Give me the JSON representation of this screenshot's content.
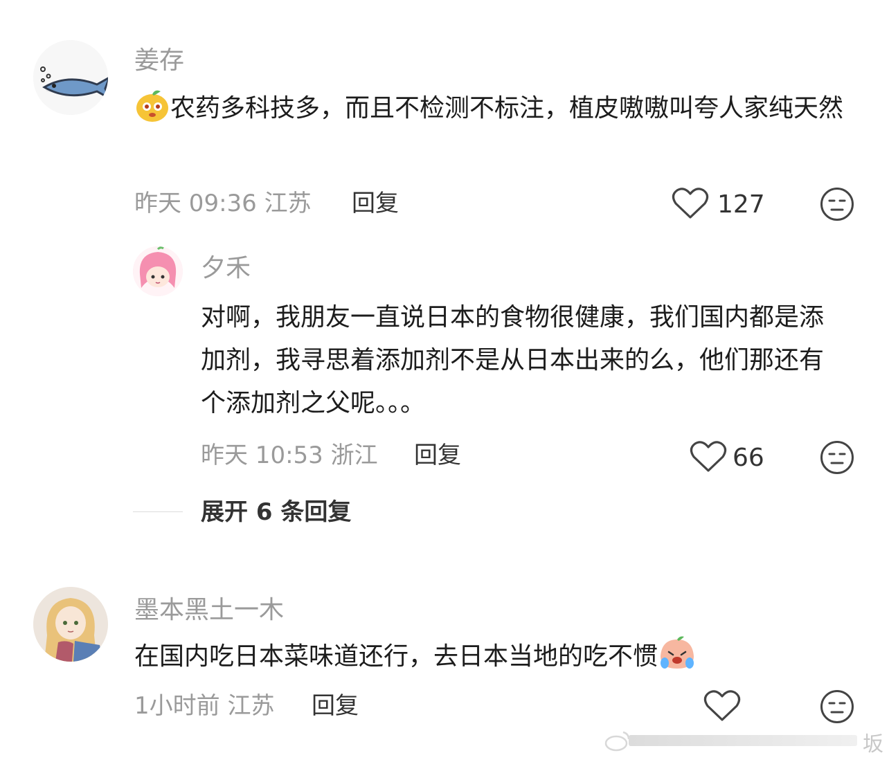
{
  "comments": [
    {
      "username": "姜存",
      "text": "农药多科技多，而且不检测不标注，植皮嗷嗷叫夸人家纯天然",
      "meta": "昨天 09:36 江苏",
      "reply_label": "回复",
      "likes": "127",
      "avatar_icon": "fish-avatar",
      "inline_emoji_icon": "orange-face-emoji"
    },
    {
      "username": "夕禾",
      "text": "对啊，我朋友一直说日本的食物很健康，我们国内都是添加剂，我寻思着添加剂不是从日本出来的么，他们那还有个添加剂之父呢。。。",
      "meta": "昨天 10:53 浙江",
      "reply_label": "回复",
      "likes": "66",
      "avatar_icon": "pink-hair-girl-avatar"
    },
    {
      "username": "墨本黑土一木",
      "text": "在国内吃日本菜味道还行，去日本当地的吃不惯",
      "meta": "1小时前 江苏",
      "reply_label": "回复",
      "likes": "",
      "avatar_icon": "anime-girl-avatar",
      "inline_emoji_icon": "crying-peach-emoji"
    }
  ],
  "expand_replies": "展开 6 条回复",
  "watermark_text": "坂",
  "colors": {
    "name": "#9a9a9a",
    "text": "#1c1c1c",
    "meta": "#9a9a9a",
    "icon": "#444444"
  }
}
